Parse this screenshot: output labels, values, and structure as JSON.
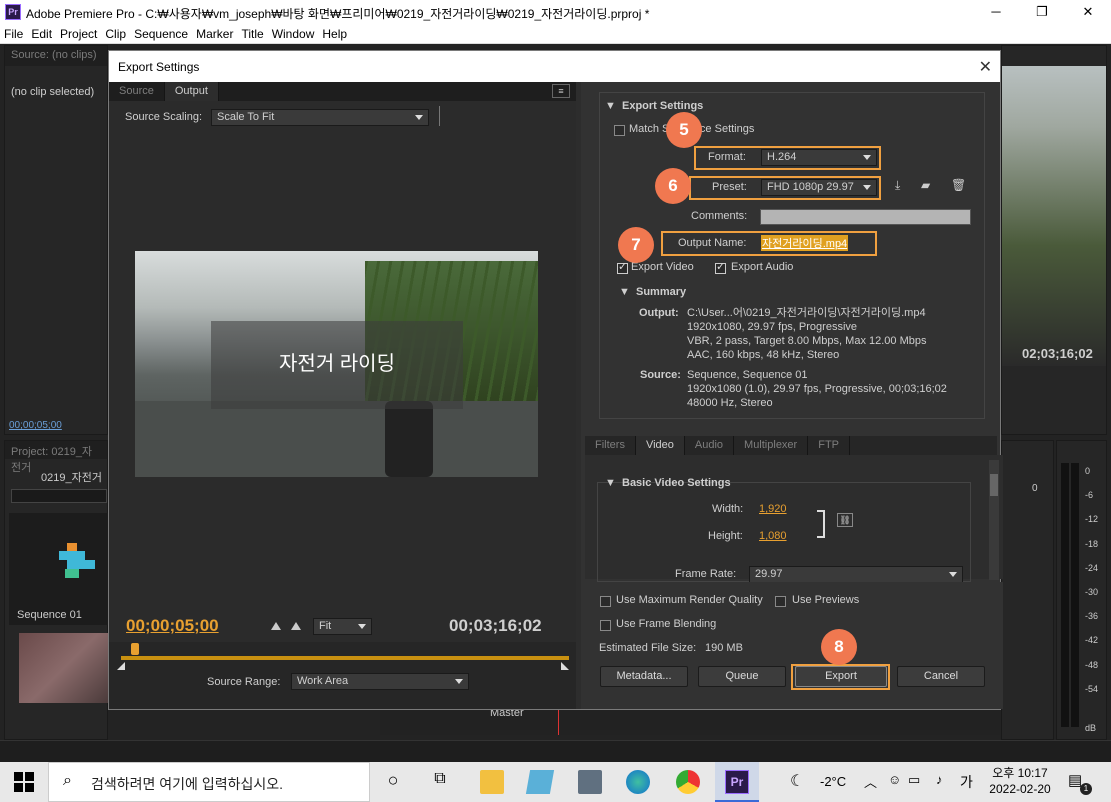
{
  "window": {
    "title": "Adobe Premiere Pro - C:₩사용자₩vm_joseph₩바탕 화면₩프리미어₩0219_자전거라이딩₩0219_자전거라이딩.prproj *",
    "minimize": "─",
    "maximize": "❐",
    "close": "✕",
    "app_icon": "Pr"
  },
  "menu": [
    "File",
    "Edit",
    "Project",
    "Clip",
    "Sequence",
    "Marker",
    "Title",
    "Window",
    "Help"
  ],
  "bg": {
    "source_tab": "Source: (no clips)",
    "no_clip": "(no clip selected)",
    "timecode_left": "00;00;05;00",
    "project_tab": "Project: 0219_자전거",
    "project_item": "0219_자전거",
    "sequence_label": "Sequence 01",
    "program_tc": "02;03;16;02",
    "master_label": "Master",
    "meter_zero": "0",
    "meter_scale": [
      "0",
      "-6",
      "-12",
      "-18",
      "-24",
      "-30",
      "-36",
      "-42",
      "-48",
      "-54"
    ],
    "meter_db": "dB"
  },
  "dialog": {
    "title": "Export Settings",
    "close": "✕",
    "tabs": [
      "Source",
      "Output"
    ],
    "source_scaling_label": "Source Scaling:",
    "source_scaling_value": "Scale To Fit",
    "video_overlay_text": "자전거 라이딩",
    "current_tc": "00;00;05;00",
    "fit_value": "Fit",
    "duration_tc": "00;03;16;02",
    "source_range_label": "Source Range:",
    "source_range_value": "Work Area",
    "export_settings_header": "Export Settings",
    "match_sequence": "Match Sequence Settings",
    "format_label": "Format:",
    "format_value": "H.264",
    "preset_label": "Preset:",
    "preset_value": "FHD 1080p 29.97",
    "comments_label": "Comments:",
    "output_name_label": "Output Name:",
    "output_name_value": "자전거라이딩.mp4",
    "export_video": "Export Video",
    "export_audio": "Export Audio",
    "summary_header": "Summary",
    "summary_output_label": "Output:",
    "summary_output_lines": [
      "C:\\User...어\\0219_자전거라이딩\\자전거라이딩.mp4",
      "1920x1080, 29.97 fps, Progressive",
      "VBR, 2 pass, Target 8.00 Mbps, Max 12.00 Mbps",
      "AAC, 160 kbps, 48 kHz, Stereo"
    ],
    "summary_source_label": "Source:",
    "summary_source_lines": [
      "Sequence, Sequence 01",
      "1920x1080 (1.0), 29.97 fps, Progressive, 00;03;16;02",
      "48000 Hz, Stereo"
    ],
    "settings_tabs": [
      "Filters",
      "Video",
      "Audio",
      "Multiplexer",
      "FTP"
    ],
    "basic_video_header": "Basic Video Settings",
    "width_label": "Width:",
    "width_value": "1,920",
    "height_label": "Height:",
    "height_value": "1,080",
    "frame_rate_label": "Frame Rate:",
    "frame_rate_value": "29.97",
    "max_render": "Use Maximum Render Quality",
    "use_previews": "Use Previews",
    "frame_blending": "Use Frame Blending",
    "est_size_label": "Estimated File Size:",
    "est_size_value": "190 MB",
    "metadata_btn": "Metadata...",
    "queue_btn": "Queue",
    "export_btn": "Export",
    "cancel_btn": "Cancel",
    "badges": [
      "5",
      "6",
      "7",
      "8"
    ]
  },
  "taskbar": {
    "search_placeholder": "검색하려면 여기에 입력하십시오.",
    "weather": "-2°C",
    "ime": "가",
    "time": "오후 10:17",
    "date": "2022-02-20",
    "notif_count": "1",
    "premiere_icon": "Pr"
  }
}
